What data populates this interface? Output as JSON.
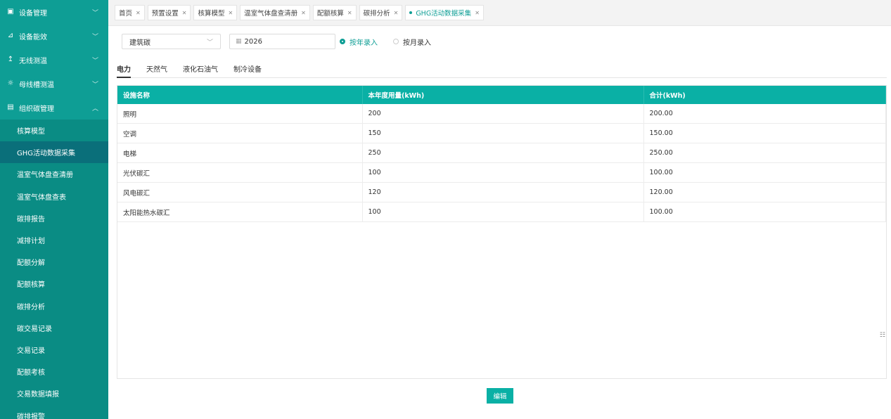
{
  "sidebar": {
    "groups": [
      {
        "label": "设备管理",
        "icon": "device-icon"
      },
      {
        "label": "设备能效",
        "icon": "chart-icon"
      },
      {
        "label": "无线测温",
        "icon": "thermometer-icon"
      },
      {
        "label": "母线槽测温",
        "icon": "sun-icon"
      },
      {
        "label": "组织碳管理",
        "icon": "org-icon"
      }
    ],
    "items": [
      "核算模型",
      "GHG活动数据采集",
      "温室气体盘查清册",
      "温室气体盘查表",
      "碳排报告",
      "减排计划",
      "配额分解",
      "配额核算",
      "碳排分析",
      "碳交易记录",
      "交易记录",
      "配额考核",
      "交易数据填报",
      "碳排报警"
    ],
    "active_item": "GHG活动数据采集"
  },
  "tabs": [
    {
      "label": "首页"
    },
    {
      "label": "预置设置"
    },
    {
      "label": "核算模型"
    },
    {
      "label": "温室气体盘查清册"
    },
    {
      "label": "配额核算"
    },
    {
      "label": "碳排分析"
    },
    {
      "label": "GHG活动数据采集",
      "active": true
    }
  ],
  "filters": {
    "category": "建筑碳",
    "year": "2026",
    "radios": [
      {
        "label": "按年录入",
        "checked": true
      },
      {
        "label": "按月录入",
        "checked": false
      }
    ]
  },
  "subtabs": [
    {
      "label": "电力",
      "active": true
    },
    {
      "label": "天然气"
    },
    {
      "label": "液化石油气"
    },
    {
      "label": "制冷设备"
    }
  ],
  "table": {
    "headers": [
      "设施名称",
      "本年度用量(kWh)",
      "合计(kWh)"
    ],
    "rows": [
      [
        "照明",
        "200",
        "200.00"
      ],
      [
        "空调",
        "150",
        "150.00"
      ],
      [
        "电梯",
        "250",
        "250.00"
      ],
      [
        "光伏碳汇",
        "100",
        "100.00"
      ],
      [
        "风电碳汇",
        "120",
        "120.00"
      ],
      [
        "太阳能热水碳汇",
        "100",
        "100.00"
      ]
    ]
  },
  "actions": {
    "edit_label": "编辑"
  },
  "colors": {
    "primary": "#0e9e95",
    "header": "#0ab0a5"
  }
}
